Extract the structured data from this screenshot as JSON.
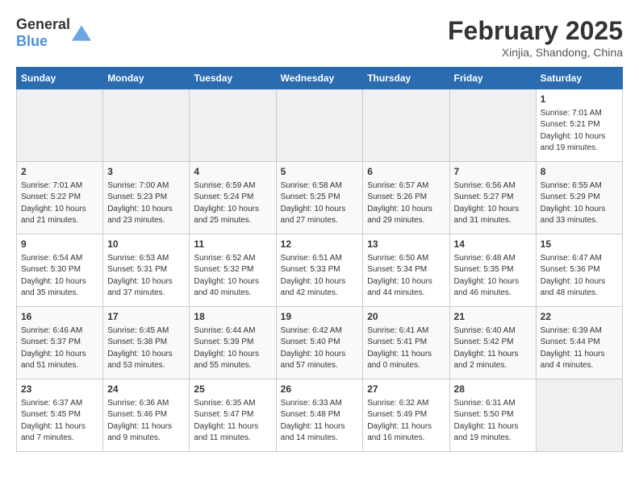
{
  "header": {
    "logo_general": "General",
    "logo_blue": "Blue",
    "month_title": "February 2025",
    "subtitle": "Xinjia, Shandong, China"
  },
  "days_of_week": [
    "Sunday",
    "Monday",
    "Tuesday",
    "Wednesday",
    "Thursday",
    "Friday",
    "Saturday"
  ],
  "weeks": [
    [
      {
        "day": "",
        "info": ""
      },
      {
        "day": "",
        "info": ""
      },
      {
        "day": "",
        "info": ""
      },
      {
        "day": "",
        "info": ""
      },
      {
        "day": "",
        "info": ""
      },
      {
        "day": "",
        "info": ""
      },
      {
        "day": "1",
        "info": "Sunrise: 7:01 AM\nSunset: 5:21 PM\nDaylight: 10 hours\nand 19 minutes."
      }
    ],
    [
      {
        "day": "2",
        "info": "Sunrise: 7:01 AM\nSunset: 5:22 PM\nDaylight: 10 hours\nand 21 minutes."
      },
      {
        "day": "3",
        "info": "Sunrise: 7:00 AM\nSunset: 5:23 PM\nDaylight: 10 hours\nand 23 minutes."
      },
      {
        "day": "4",
        "info": "Sunrise: 6:59 AM\nSunset: 5:24 PM\nDaylight: 10 hours\nand 25 minutes."
      },
      {
        "day": "5",
        "info": "Sunrise: 6:58 AM\nSunset: 5:25 PM\nDaylight: 10 hours\nand 27 minutes."
      },
      {
        "day": "6",
        "info": "Sunrise: 6:57 AM\nSunset: 5:26 PM\nDaylight: 10 hours\nand 29 minutes."
      },
      {
        "day": "7",
        "info": "Sunrise: 6:56 AM\nSunset: 5:27 PM\nDaylight: 10 hours\nand 31 minutes."
      },
      {
        "day": "8",
        "info": "Sunrise: 6:55 AM\nSunset: 5:29 PM\nDaylight: 10 hours\nand 33 minutes."
      }
    ],
    [
      {
        "day": "9",
        "info": "Sunrise: 6:54 AM\nSunset: 5:30 PM\nDaylight: 10 hours\nand 35 minutes."
      },
      {
        "day": "10",
        "info": "Sunrise: 6:53 AM\nSunset: 5:31 PM\nDaylight: 10 hours\nand 37 minutes."
      },
      {
        "day": "11",
        "info": "Sunrise: 6:52 AM\nSunset: 5:32 PM\nDaylight: 10 hours\nand 40 minutes."
      },
      {
        "day": "12",
        "info": "Sunrise: 6:51 AM\nSunset: 5:33 PM\nDaylight: 10 hours\nand 42 minutes."
      },
      {
        "day": "13",
        "info": "Sunrise: 6:50 AM\nSunset: 5:34 PM\nDaylight: 10 hours\nand 44 minutes."
      },
      {
        "day": "14",
        "info": "Sunrise: 6:48 AM\nSunset: 5:35 PM\nDaylight: 10 hours\nand 46 minutes."
      },
      {
        "day": "15",
        "info": "Sunrise: 6:47 AM\nSunset: 5:36 PM\nDaylight: 10 hours\nand 48 minutes."
      }
    ],
    [
      {
        "day": "16",
        "info": "Sunrise: 6:46 AM\nSunset: 5:37 PM\nDaylight: 10 hours\nand 51 minutes."
      },
      {
        "day": "17",
        "info": "Sunrise: 6:45 AM\nSunset: 5:38 PM\nDaylight: 10 hours\nand 53 minutes."
      },
      {
        "day": "18",
        "info": "Sunrise: 6:44 AM\nSunset: 5:39 PM\nDaylight: 10 hours\nand 55 minutes."
      },
      {
        "day": "19",
        "info": "Sunrise: 6:42 AM\nSunset: 5:40 PM\nDaylight: 10 hours\nand 57 minutes."
      },
      {
        "day": "20",
        "info": "Sunrise: 6:41 AM\nSunset: 5:41 PM\nDaylight: 11 hours\nand 0 minutes."
      },
      {
        "day": "21",
        "info": "Sunrise: 6:40 AM\nSunset: 5:42 PM\nDaylight: 11 hours\nand 2 minutes."
      },
      {
        "day": "22",
        "info": "Sunrise: 6:39 AM\nSunset: 5:44 PM\nDaylight: 11 hours\nand 4 minutes."
      }
    ],
    [
      {
        "day": "23",
        "info": "Sunrise: 6:37 AM\nSunset: 5:45 PM\nDaylight: 11 hours\nand 7 minutes."
      },
      {
        "day": "24",
        "info": "Sunrise: 6:36 AM\nSunset: 5:46 PM\nDaylight: 11 hours\nand 9 minutes."
      },
      {
        "day": "25",
        "info": "Sunrise: 6:35 AM\nSunset: 5:47 PM\nDaylight: 11 hours\nand 11 minutes."
      },
      {
        "day": "26",
        "info": "Sunrise: 6:33 AM\nSunset: 5:48 PM\nDaylight: 11 hours\nand 14 minutes."
      },
      {
        "day": "27",
        "info": "Sunrise: 6:32 AM\nSunset: 5:49 PM\nDaylight: 11 hours\nand 16 minutes."
      },
      {
        "day": "28",
        "info": "Sunrise: 6:31 AM\nSunset: 5:50 PM\nDaylight: 11 hours\nand 19 minutes."
      },
      {
        "day": "",
        "info": ""
      }
    ]
  ]
}
